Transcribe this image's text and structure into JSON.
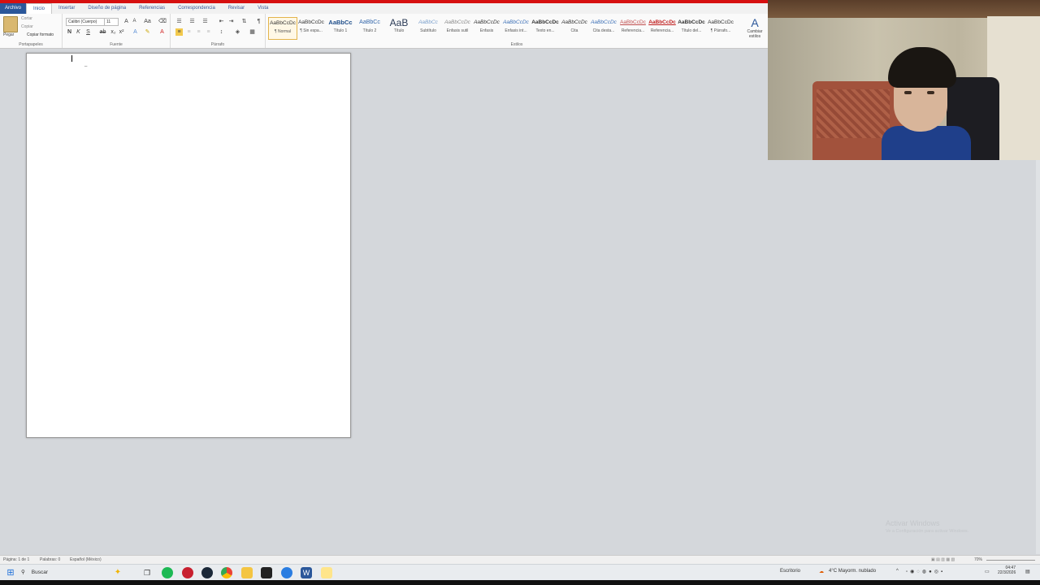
{
  "ribbon_tabs": [
    "Archivo",
    "Inicio",
    "Insertar",
    "Diseño de página",
    "Referencias",
    "Correspondencia",
    "Revisar",
    "Vista"
  ],
  "clipboard": {
    "paste": "Pegar",
    "cut": "Cortar",
    "copy": "Copiar",
    "format_painter": "Copiar formato",
    "label": "Portapapeles"
  },
  "font": {
    "name": "Calibri (Cuerpo)",
    "size": "11",
    "label": "Fuente",
    "bold": "N",
    "italic": "K",
    "underline": "S"
  },
  "paragraph": {
    "label": "Párrafo",
    "pilcrow": "¶"
  },
  "styles": {
    "label": "Estilos",
    "items": [
      {
        "preview": "AaBbCcDc",
        "name": "¶ Normal"
      },
      {
        "preview": "AaBbCcDc",
        "name": "¶ Sin espa..."
      },
      {
        "preview": "AaBbCc",
        "name": "Título 1"
      },
      {
        "preview": "AaBbCc",
        "name": "Título 2"
      },
      {
        "preview": "AaB",
        "name": "Título"
      },
      {
        "preview": "AaBbCc",
        "name": "Subtítulo"
      },
      {
        "preview": "AaBbCcDc",
        "name": "Énfasis sutil"
      },
      {
        "preview": "AaBbCcDc",
        "name": "Énfasis"
      },
      {
        "preview": "AaBbCcDc",
        "name": "Énfasis int..."
      },
      {
        "preview": "AaBbCcDc",
        "name": "Texto en..."
      },
      {
        "preview": "AaBbCcDc",
        "name": "Cita"
      },
      {
        "preview": "AaBbCcDc",
        "name": "Cita desta..."
      },
      {
        "preview": "AaBbCcDc",
        "name": "Referencia..."
      },
      {
        "preview": "AaBbCcDc",
        "name": "Referencia..."
      },
      {
        "preview": "AaBbCcDc",
        "name": "Título del..."
      },
      {
        "preview": "AaBbCcDc",
        "name": "¶ Párrafo..."
      }
    ],
    "change": "Cambiar estilos"
  },
  "statusbar": {
    "page": "Página: 1 de 1",
    "words": "Palabras: 0",
    "language": "Español (México)",
    "zoom": "70%"
  },
  "watermark": {
    "line1": "Activar Windows",
    "line2": "Ve a Configuración para activar Windows."
  },
  "taskbar": {
    "search": "Buscar",
    "desktop": "Escritorio",
    "weather": "4°C  Mayorm. nublado",
    "time": "04:47",
    "date": "22/3/2026"
  },
  "colors": {
    "title_red": "#d60f0f",
    "file_tab": "#2b579a"
  }
}
